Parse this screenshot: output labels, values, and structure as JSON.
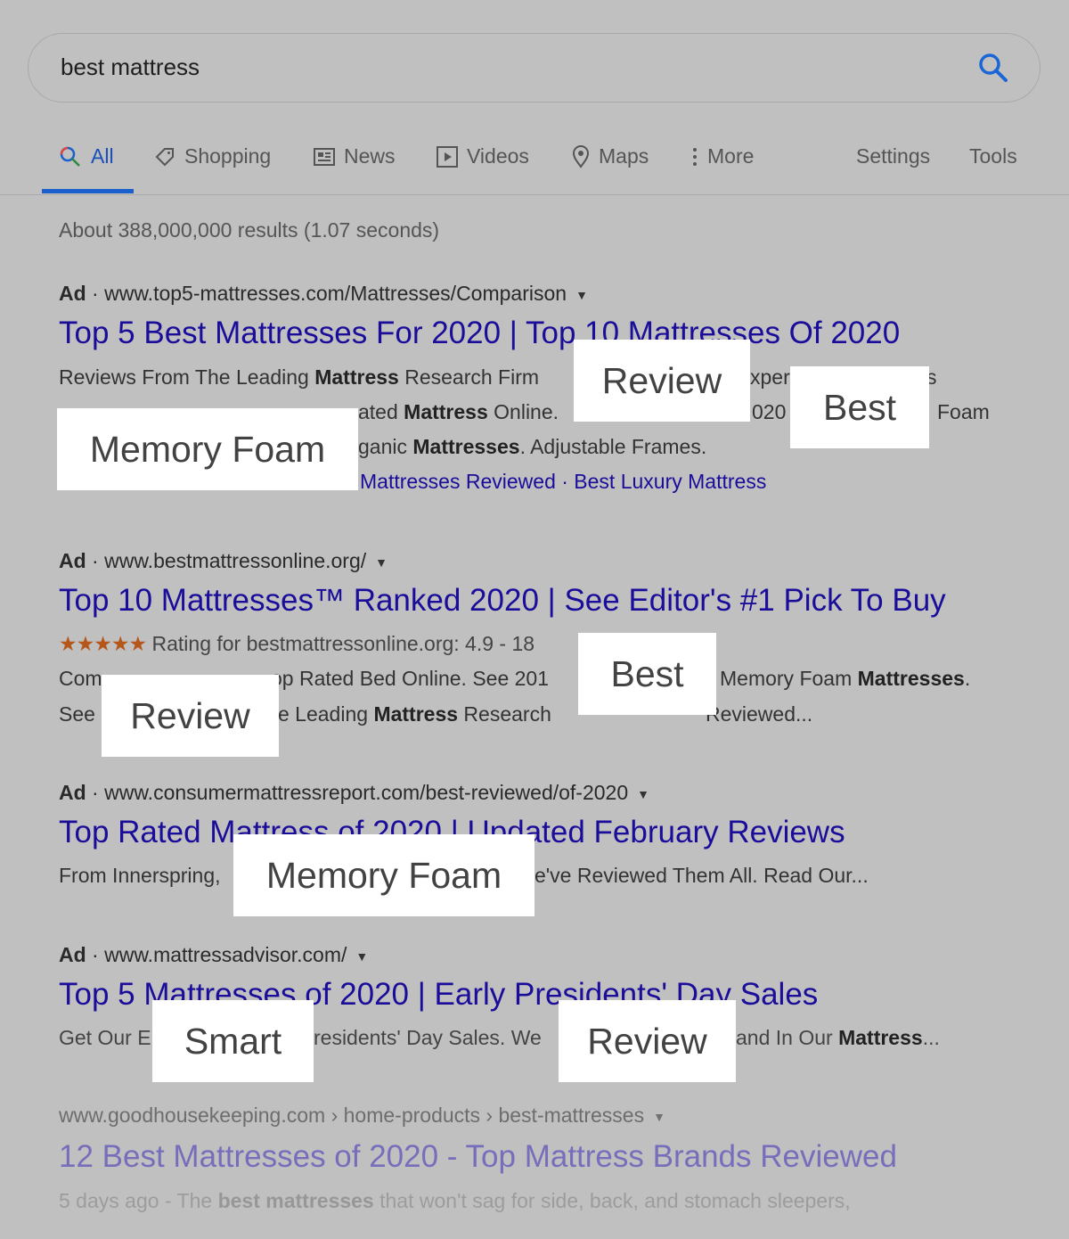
{
  "search": {
    "query": "best mattress"
  },
  "tabs": [
    {
      "label": "All",
      "icon": "search-icon",
      "active": true
    },
    {
      "label": "Shopping",
      "icon": "tag-icon"
    },
    {
      "label": "News",
      "icon": "newspaper-icon"
    },
    {
      "label": "Videos",
      "icon": "play-icon"
    },
    {
      "label": "Maps",
      "icon": "map-pin-icon"
    },
    {
      "label": "More",
      "icon": "more-vertical-icon"
    }
  ],
  "tools": {
    "settings": "Settings",
    "tools": "Tools"
  },
  "stats": "About 388,000,000 results (1.07 seconds)",
  "colors": {
    "background": "#c0c0c0",
    "link": "#1a0d9a",
    "accent": "#1a5fcc",
    "stars": "#b5561a"
  },
  "results": [
    {
      "ad": "Ad",
      "url": "www.top5-mattresses.com/Mattresses/Comparison",
      "title": "Top 5 Best Mattresses For 2020 | Top 10 Mattresses Of 2020",
      "l1a": "Reviews From The Leading ",
      "l1b": "Mattress",
      "l1c": " Research Firm",
      "l1d": "xpert",
      "l1e": "s",
      "l2a": "ated ",
      "l2b": "Mattress",
      "l2c": " Online.",
      "l2d": "020",
      "l2e": "Foam",
      "l3a": "ganic ",
      "l3b": "Mattresses",
      "l3c": ". Adjustable Frames.",
      "sitelinks": "Mattresses Reviewed · Best Luxury Mattress"
    },
    {
      "ad": "Ad",
      "url": "www.bestmattressonline.org/",
      "title": "Top 10 Mattresses™ Ranked 2020 | See Editor's #1 Pick To Buy",
      "stars": "★★★★★",
      "rating": "Rating for bestmattressonline.org: 4.9 - 18",
      "l1a": "Com",
      "l1b": "op Rated Bed Online. See 201",
      "l1c": "Memory Foam ",
      "l1d": "Mattresses",
      ".l1e": ".",
      "l1e": ".",
      "l2a": "See",
      "l2b": "e Leading ",
      "l2c": "Mattress",
      "l2d": " Research ",
      "l2e": "Reviewed..."
    },
    {
      "ad": "Ad",
      "url": "www.consumermattressreport.com/best-reviewed/of-2020",
      "title": "Top Rated Mattress of 2020 | Updated February Reviews",
      "l1a": "From Innerspring,",
      "l1b": "e've Reviewed Them All. Read Our..."
    },
    {
      "ad": "Ad",
      "url": "www.mattressadvisor.com/",
      "title": "Top 5 Mattresses of 2020 | Early Presidents' Day Sales",
      "l1a": "Get Our E",
      "l1b": "residents' Day Sales. We",
      "l1c": "and In Our ",
      "l1d": "Mattress",
      "l1e": "..."
    },
    {
      "url": "www.goodhousekeeping.com › home-products › best-mattresses",
      "title": "12 Best Mattresses of 2020 - Top Mattress Brands Reviewed",
      "snippet_a": "5 days ago - The ",
      "snippet_b": "best mattresses",
      "snippet_c": " that won't sag for side, back, and stomach sleepers,"
    }
  ],
  "overlays": [
    "Review",
    "Best",
    "Memory Foam",
    "Best",
    "Review",
    "Memory Foam",
    "Smart",
    "Review"
  ]
}
